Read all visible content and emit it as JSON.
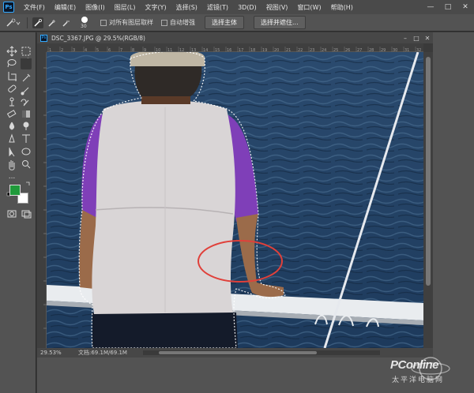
{
  "app": {
    "logo": "Ps",
    "menu": [
      "文件(F)",
      "编辑(E)",
      "图像(I)",
      "图层(L)",
      "文字(Y)",
      "选择(S)",
      "滤镜(T)",
      "3D(D)",
      "视图(V)",
      "窗口(W)",
      "帮助(H)"
    ],
    "window_controls": [
      "—",
      "□",
      "✕"
    ]
  },
  "options_bar": {
    "brush_size": "30",
    "sample_all_layers": "对所有图层取样",
    "auto_enhance": "自动增强",
    "select_subject": "选择主体",
    "select_and_mask": "选择并遮住..."
  },
  "toolbar": {
    "foreground_color": "#1f9a3a",
    "background_color": "#ffffff",
    "more_tools": "..."
  },
  "document": {
    "title": "DSC_3367.JPG @ 29.5%(RGB/8)",
    "zoom": "29.53%",
    "doc_info": "文档:69.1M/69.1M",
    "ruler_labels": [
      "1",
      "2",
      "3",
      "4",
      "5",
      "6",
      "7",
      "8",
      "9",
      "10",
      "11",
      "12",
      "13",
      "14",
      "15",
      "16",
      "17",
      "18",
      "19",
      "20",
      "21",
      "22",
      "23",
      "24",
      "25",
      "26",
      "27",
      "28",
      "29",
      "30",
      "31",
      "32"
    ]
  },
  "watermark": {
    "brand": "PConline",
    "sub": "太平洋电脑网"
  }
}
